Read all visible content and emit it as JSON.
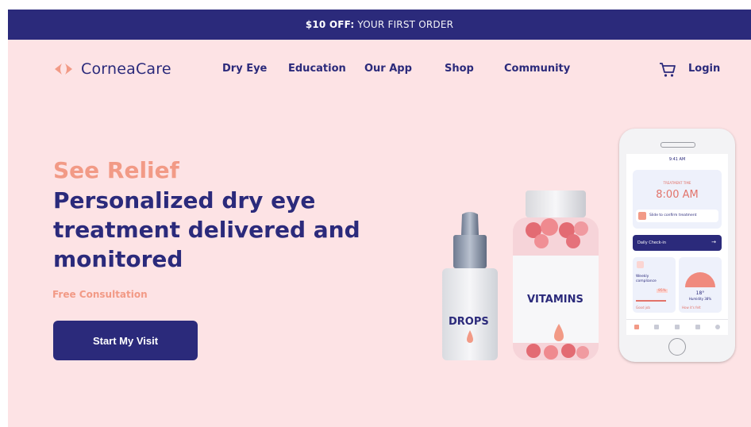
{
  "banner": {
    "highlight": "$10 OFF:",
    "text": "YOUR FIRST ORDER"
  },
  "brand": {
    "name": "CorneaCare"
  },
  "nav": {
    "links": [
      "Dry Eye",
      "Education",
      "Our App",
      "Shop",
      "Community"
    ],
    "login": "Login"
  },
  "hero": {
    "kicker": "See Relief",
    "title": "Personalized dry eye treatment delivered and monitored",
    "subtext": "Free Consultation",
    "cta": "Start My Visit"
  },
  "products": {
    "drops_label": "DROPS",
    "vitamins_label": "VITAMINS"
  },
  "phone": {
    "time_small": "9:41 AM",
    "reminder_label": "TREATMENT TIME",
    "time_big": "8:00 AM",
    "slide_text": "Slide to confirm treatment",
    "daily_checkin": "Daily Check-in",
    "arrow": "→",
    "weekly_label": "Weekly compliance",
    "weekly_value": "95%",
    "weekly_link": "Good job",
    "temp_value": "18°",
    "humidity": "Humidity 38%",
    "weather_link": "How it's felt"
  },
  "colors": {
    "navy": "#2b2a7b",
    "peach": "#f29a86",
    "bg": "#fde3e5"
  }
}
